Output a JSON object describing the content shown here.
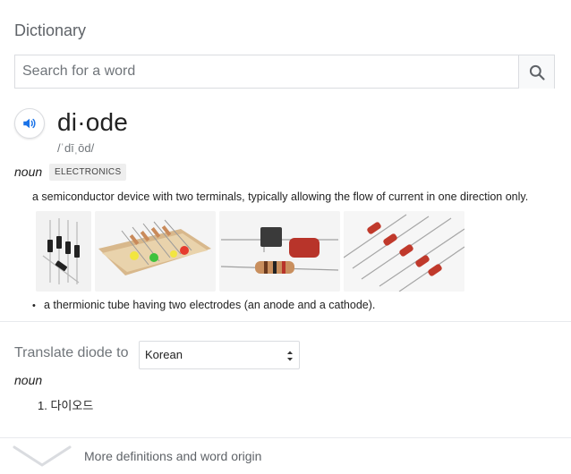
{
  "panel": {
    "title": "Dictionary"
  },
  "search": {
    "placeholder": "Search for a word"
  },
  "entry": {
    "word": "di·ode",
    "phonetic": "/ˈdīˌōd/",
    "part_of_speech": "noun",
    "domain_label": "ELECTRONICS",
    "definition_1": "a semiconductor device with two terminals, typically allowing the flow of current in one direction only.",
    "definition_2": "a thermionic tube having two electrodes (an anode and a cathode).",
    "bullet": "•"
  },
  "translate": {
    "label": "Translate diode to",
    "language": "Korean",
    "part_of_speech": "noun",
    "items": [
      {
        "number": "1.",
        "text": "다이오드"
      }
    ]
  },
  "footer": {
    "more_label": "More definitions and word origin"
  },
  "icons": {
    "search": "search-icon",
    "speaker": "speaker-icon",
    "expand": "chevron-down-icon"
  },
  "colors": {
    "accent_blue": "#1a73e8",
    "diode_red": "#c0392b"
  }
}
